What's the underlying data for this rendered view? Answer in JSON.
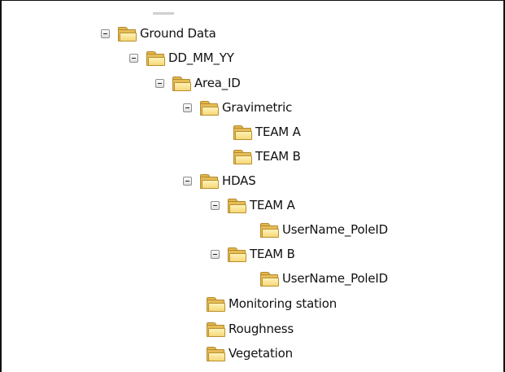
{
  "tree": {
    "ground_data": "Ground Data",
    "date": "DD_MM_YY",
    "area": "Area_ID",
    "gravimetric": "Gravimetric",
    "grav_team_a": "TEAM A",
    "grav_team_b": "TEAM B",
    "hdas": "HDAS",
    "hdas_team_a": "TEAM A",
    "hdas_team_a_user": "UserName_PoleID",
    "hdas_team_b": "TEAM B",
    "hdas_team_b_user": "UserName_PoleID",
    "monitoring": "Monitoring station",
    "roughness": "Roughness",
    "vegetation": "Vegetation"
  },
  "icons": {
    "expanded": "collapse-minus-icon",
    "folder": "folder-icon"
  },
  "colors": {
    "folder_fill": "#e7bc56",
    "folder_front": "#f6d778",
    "folder_edge": "#b08a2d"
  }
}
